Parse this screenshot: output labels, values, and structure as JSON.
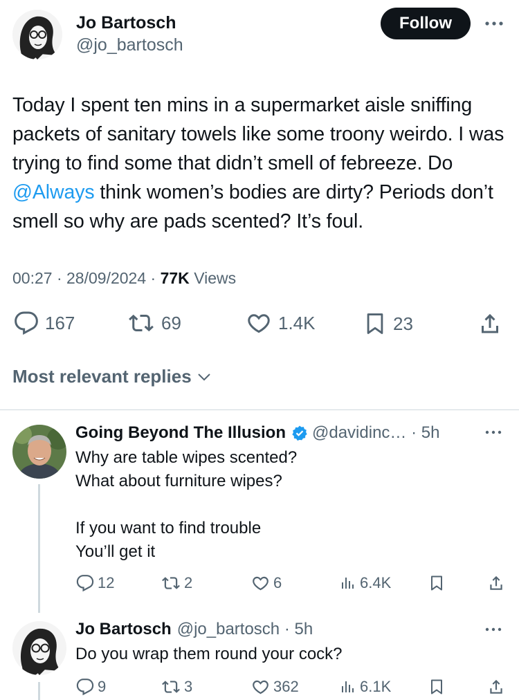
{
  "tweet": {
    "author_name": "Jo Bartosch",
    "author_handle": "@jo_bartosch",
    "follow_label": "Follow",
    "text_before": "Today I spent ten mins in a supermarket aisle sniffing packets of sanitary towels like some troony weirdo. I was trying to find some that didn’t smell of febreeze. Do ",
    "mention": "@Always",
    "text_after": " think women’s bodies are dirty? Periods don’t smell so why are pads scented? It’s foul.",
    "time": "00:27",
    "date": "28/09/2024",
    "views_count": "77K",
    "views_label": "Views",
    "replies": "167",
    "reposts": "69",
    "likes": "1.4K",
    "bookmarks": "23"
  },
  "replies_header": "Most relevant replies",
  "replies": [
    {
      "name": "Going Beyond The Illusion",
      "handle": "@davidinc…",
      "time": "5h",
      "lines": [
        "Why are table wipes scented?",
        "What about furniture wipes?",
        "",
        "If you want to find trouble",
        "You’ll get it"
      ],
      "replies": "12",
      "reposts": "2",
      "likes": "6",
      "views": "6.4K"
    },
    {
      "name": "Jo Bartosch",
      "handle": "@jo_bartosch",
      "time": "5h",
      "lines": [
        "Do you wrap them round your cock?"
      ],
      "replies": "9",
      "reposts": "3",
      "likes": "362",
      "views": "6.1K"
    }
  ],
  "colors": {
    "text": "#0f1419",
    "secondary": "#536471",
    "link": "#1d9bf0",
    "verified": "#1d9bf0",
    "divider": "#cfd9de"
  },
  "icons": [
    "more-icon",
    "reply-icon",
    "repost-icon",
    "like-icon",
    "bookmark-icon",
    "share-icon",
    "views-icon",
    "chevron-down-icon",
    "verified-badge-icon"
  ]
}
